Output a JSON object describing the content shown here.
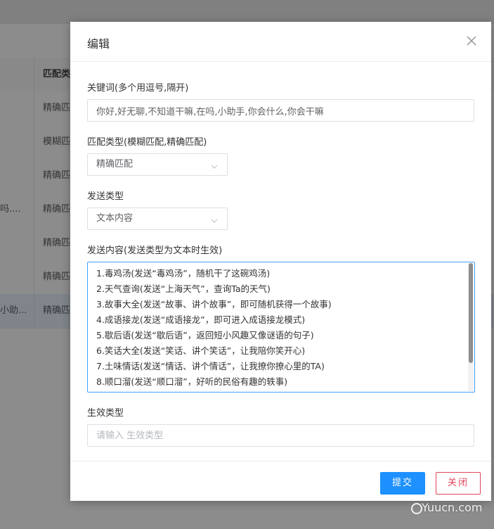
{
  "background": {
    "table_header": {
      "col_a": "",
      "col_b": "匹配类"
    },
    "rows": [
      {
        "col_a": "",
        "col_b": "精确匹",
        "selected": false
      },
      {
        "col_a": "",
        "col_b": "模糊匹",
        "selected": false
      },
      {
        "col_a": "",
        "col_b": "精确匹",
        "selected": false
      },
      {
        "col_a": "吗....",
        "col_b": "精确匹",
        "selected": false
      },
      {
        "col_a": "",
        "col_b": "精确匹",
        "selected": false
      },
      {
        "col_a": "",
        "col_b": "精确匹",
        "selected": false
      },
      {
        "col_a": "小助...",
        "col_b": "精确匹",
        "selected": true
      }
    ]
  },
  "dialog": {
    "title": "编辑",
    "close_icon": "close-icon",
    "keywords": {
      "label": "关键词(多个用逗号,隔开)",
      "value": "你好,好无聊,不知道干嘛,在吗,小助手,你会什么,你会干嘛"
    },
    "match_type": {
      "label": "匹配类型(模糊匹配,精确匹配)",
      "value": "精确匹配"
    },
    "send_type": {
      "label": "发送类型",
      "value": "文本内容"
    },
    "send_content": {
      "label": "发送内容(发送类型为文本时生效)",
      "lines": [
        "1.毒鸡汤(发送“毒鸡汤”，随机干了这碗鸡汤)",
        "2.天气查询(发送“上海天气”，查询Ta的天气)",
        "3.故事大全(发送“故事、讲个故事”，即可随机获得一个故事)",
        "4.成语接龙(发送“成语接龙”，即可进入成语接龙模式)",
        "5.歇后语(发送“歇后语”，返回短小风趣又像谜语的句子)",
        "6.笑话大全(发送“笑话、讲个笑话”，让我陪你笑开心)",
        "7.土味情话(发送“情话、讲个情话”，让我撩你撩心里的TA)",
        "8.顺口溜(发送“顺口溜”，好听的民俗有趣的轶事)"
      ]
    },
    "effect_type": {
      "label": "生效类型",
      "value": "",
      "placeholder": "请输入 生效类型"
    },
    "buttons": {
      "submit": "提交",
      "close": "关闭"
    }
  },
  "watermark": {
    "text": "Yuucn.com"
  },
  "colors": {
    "primary": "#1e90ff",
    "danger": "#e0455a",
    "focus_border": "#409eff"
  }
}
